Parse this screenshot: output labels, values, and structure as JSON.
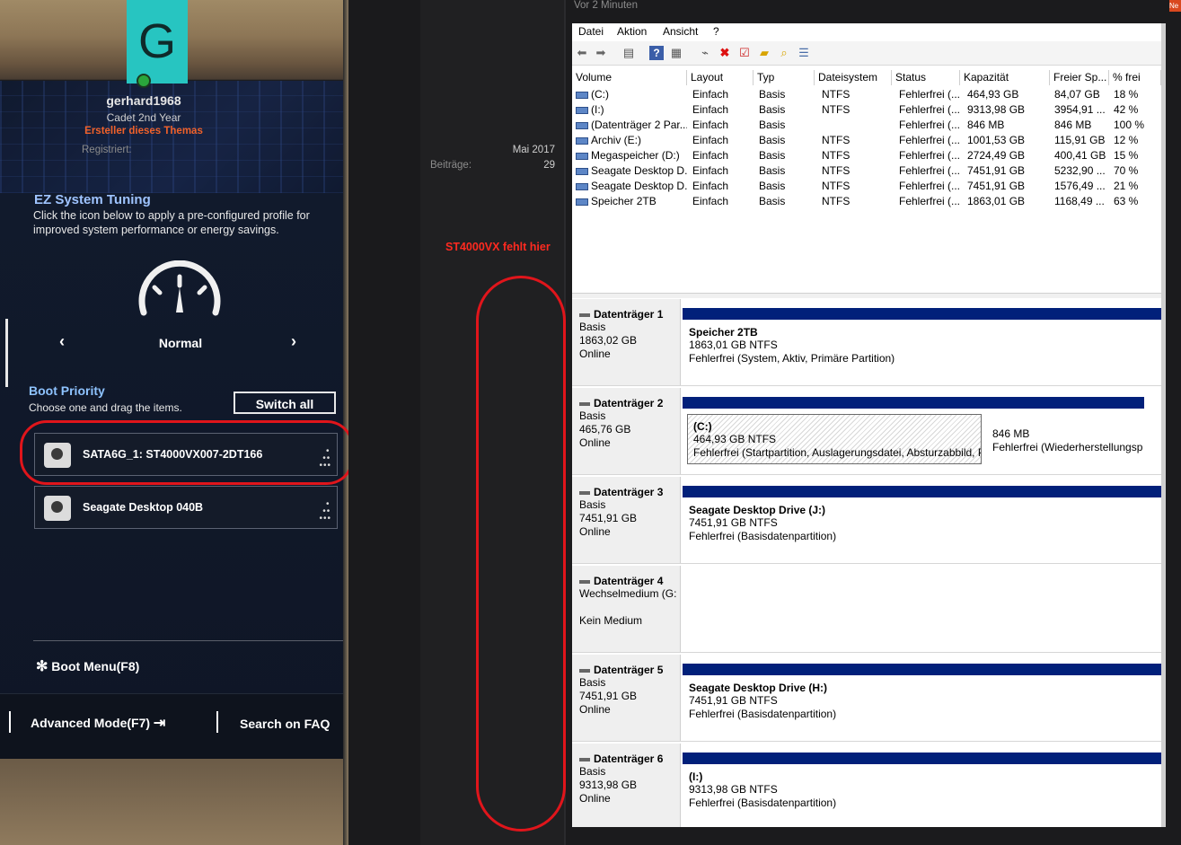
{
  "bios": {
    "ez_title": "EZ System Tuning",
    "ez_desc": "Click the icon below to apply a pre-configured profile for improved system performance or energy savings.",
    "mode_prev": "‹",
    "mode_label": "Normal",
    "mode_next": "›",
    "boot_title": "Boot Priority",
    "boot_desc": "Choose one and drag the items.",
    "switch_all": "Switch all",
    "boot_items": [
      {
        "label": "SATA6G_1: ST4000VX007-2DT166"
      },
      {
        "label": "Seagate Desktop 040B"
      }
    ],
    "boot_menu": "Boot Menu(F8)",
    "advanced_mode": "Advanced Mode(F7)",
    "search_faq": "Search on FAQ"
  },
  "forum": {
    "avatar_letter": "G",
    "username": "gerhard1968",
    "rank": "Cadet 2nd Year",
    "creator": "Ersteller dieses Themas",
    "registered_label": "Registriert:",
    "registered_value": "Mai 2017",
    "posts_label": "Beiträge:",
    "posts_value": "29",
    "annotation": "ST4000VX fehlt hier",
    "time": "Vor 2 Minuten",
    "corner_badge": "Ne"
  },
  "diskmgmt": {
    "menu": [
      "Datei",
      "Aktion",
      "Ansicht",
      "?"
    ],
    "columns": [
      "Volume",
      "Layout",
      "Typ",
      "Dateisystem",
      "Status",
      "Kapazität",
      "Freier Sp...",
      "% frei"
    ],
    "volumes": [
      [
        "(C:)",
        "Einfach",
        "Basis",
        "NTFS",
        "Fehlerfrei (...",
        "464,93 GB",
        "84,07 GB",
        "18 %"
      ],
      [
        "(I:)",
        "Einfach",
        "Basis",
        "NTFS",
        "Fehlerfrei (...",
        "9313,98 GB",
        "3954,91 ...",
        "42 %"
      ],
      [
        "(Datenträger 2 Par...",
        "Einfach",
        "Basis",
        "",
        "Fehlerfrei (...",
        "846 MB",
        "846 MB",
        "100 %"
      ],
      [
        "Archiv (E:)",
        "Einfach",
        "Basis",
        "NTFS",
        "Fehlerfrei (...",
        "1001,53 GB",
        "115,91 GB",
        "12 %"
      ],
      [
        "Megaspeicher (D:)",
        "Einfach",
        "Basis",
        "NTFS",
        "Fehlerfrei (...",
        "2724,49 GB",
        "400,41 GB",
        "15 %"
      ],
      [
        "Seagate Desktop D...",
        "Einfach",
        "Basis",
        "NTFS",
        "Fehlerfrei (...",
        "7451,91 GB",
        "5232,90 ...",
        "70 %"
      ],
      [
        "Seagate Desktop D...",
        "Einfach",
        "Basis",
        "NTFS",
        "Fehlerfrei (...",
        "7451,91 GB",
        "1576,49 ...",
        "21 %"
      ],
      [
        "Speicher 2TB",
        "Einfach",
        "Basis",
        "NTFS",
        "Fehlerfrei (...",
        "1863,01 GB",
        "1168,49 ...",
        "63 %"
      ]
    ],
    "disks": [
      {
        "name": "Datenträger 1",
        "type": "Basis",
        "size": "1863,02 GB",
        "state": "Online",
        "parts": [
          {
            "title": "Speicher 2TB",
            "size": "1863,01 GB NTFS",
            "status": "Fehlerfrei (System, Aktiv, Primäre Partition)"
          }
        ]
      },
      {
        "name": "Datenträger 2",
        "type": "Basis",
        "size": "465,76 GB",
        "state": "Online",
        "parts": [
          {
            "title": "(C:)",
            "size": "464,93 GB NTFS",
            "status": "Fehlerfrei (Startpartition, Auslagerungsdatei, Absturzabbild, Pr"
          },
          {
            "title": "",
            "size": "846 MB",
            "status": "Fehlerfrei (Wiederherstellungsp"
          }
        ]
      },
      {
        "name": "Datenträger 3",
        "type": "Basis",
        "size": "7451,91 GB",
        "state": "Online",
        "parts": [
          {
            "title": "Seagate Desktop Drive  (J:)",
            "size": "7451,91 GB NTFS",
            "status": "Fehlerfrei (Basisdatenpartition)"
          }
        ]
      },
      {
        "name": "Datenträger 4",
        "type": "Wechselmedium (G:",
        "size": "",
        "state": "Kein Medium",
        "parts": []
      },
      {
        "name": "Datenträger 5",
        "type": "Basis",
        "size": "7451,91 GB",
        "state": "Online",
        "parts": [
          {
            "title": "Seagate Desktop Drive  (H:)",
            "size": "7451,91 GB NTFS",
            "status": "Fehlerfrei (Basisdatenpartition)"
          }
        ]
      },
      {
        "name": "Datenträger 6",
        "type": "Basis",
        "size": "9313,98 GB",
        "state": "Online",
        "parts": [
          {
            "title": "(I:)",
            "size": "9313,98 GB NTFS",
            "status": "Fehlerfrei (Basisdatenpartition)"
          }
        ]
      }
    ]
  },
  "colors": {
    "annotation_red": "#e0151b",
    "partition_header": "#01207a",
    "avatar_bg": "#27c5c1",
    "creator_orange": "#f0612a"
  }
}
